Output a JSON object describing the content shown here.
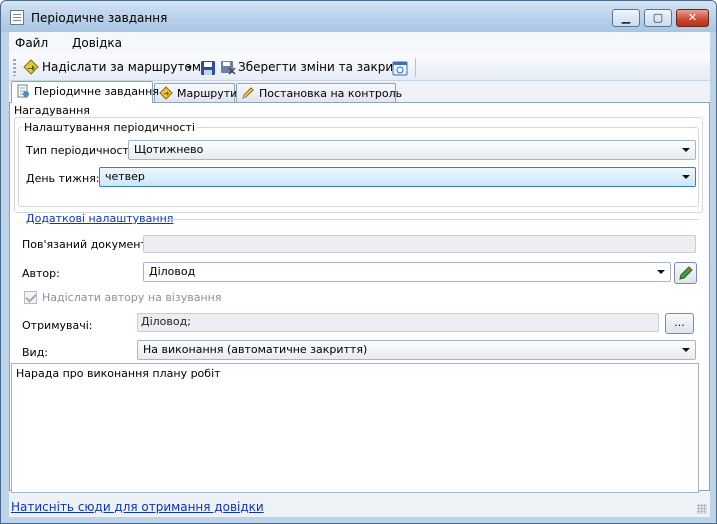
{
  "window": {
    "title": "Періодичне завдання",
    "controls": {
      "minimize": "▁",
      "maximize": "▢",
      "close": "✕"
    }
  },
  "menu": {
    "items": [
      "Файл",
      "Довідка"
    ]
  },
  "toolbar": {
    "send_route": "Надіслати за маршрутом",
    "save_close": "Зберегти зміни та закрити",
    "icons": [
      "route-send-icon",
      "dropdown-arrow-icon",
      "save-icon",
      "save-close-icon",
      "calendar-icon"
    ]
  },
  "tabs": [
    {
      "label": "Періодичне завдання",
      "icon": "periodic-task-icon",
      "active": true
    },
    {
      "label": "Маршрути",
      "icon": "route-icon",
      "active": false
    },
    {
      "label": "Постановка на контроль",
      "icon": "control-pencil-icon",
      "active": false
    }
  ],
  "reminder": {
    "group_title": "Нагадування",
    "periodicity_title": "Налаштування періодичності",
    "type_label": "Тип періодичності:",
    "type_value": "Щотижнево",
    "day_label": "День тижня:",
    "day_value": "четвер"
  },
  "extra": {
    "link": "Додаткові налаштування",
    "linked_doc_label": "Пов'язаний документ:",
    "linked_doc_value": "",
    "author_label": "Автор:",
    "author_value": "Діловод",
    "send_to_author_label": "Надіслати автору на візування",
    "recipients_label": "Отримувачі:",
    "recipients_value": "Діловод;",
    "recipients_button": "...",
    "kind_label": "Вид:",
    "kind_value": "На виконання (автоматичне закриття)"
  },
  "description": "Нарада про виконання плану робіт",
  "status": {
    "help_link": "Натисніть сюди для отримання довідки"
  },
  "colors": {
    "link": "#0b37b8",
    "focus": "#3c7fb1",
    "close": "#c9472f"
  }
}
